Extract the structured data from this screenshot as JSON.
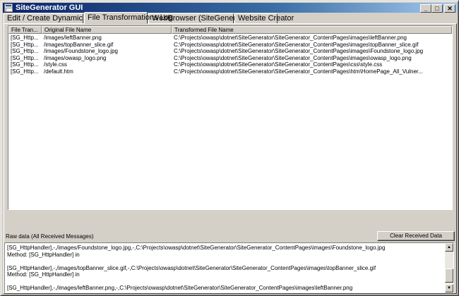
{
  "window": {
    "title": "SiteGenerator GUI",
    "controls": {
      "minimize": "_",
      "maximize": "□",
      "close": "✕"
    }
  },
  "tabs": [
    {
      "label": "Edit / Create Dynamic Websites"
    },
    {
      "label": "File Transformations Log"
    },
    {
      "label": "WebBrowser (SiteGenerator Sites)"
    },
    {
      "label": "Website Creator"
    }
  ],
  "log_table": {
    "columns": [
      "File Tran...",
      "Original File Name",
      "Transformed File Name"
    ],
    "rows": [
      [
        "[SG_Http...",
        "/images/leftBanner.png",
        "C:\\Projects\\owasp\\dotnet\\SiteGenerator\\SiteGenerator_ContentPages\\images\\leftBanner.png"
      ],
      [
        "[SG_Http...",
        "/images/topBanner_slice.gif",
        "C:\\Projects\\owasp\\dotnet\\SiteGenerator\\SiteGenerator_ContentPages\\images\\topBanner_slice.gif"
      ],
      [
        "[SG_Http...",
        "/images/Foundstone_logo.jpg",
        "C:\\Projects\\owasp\\dotnet\\SiteGenerator\\SiteGenerator_ContentPages\\images\\Foundstone_logo.jpg"
      ],
      [
        "[SG_Http...",
        "/images/owasp_logo.png",
        "C:\\Projects\\owasp\\dotnet\\SiteGenerator\\SiteGenerator_ContentPages\\images\\owasp_logo.png"
      ],
      [
        "[SG_Http...",
        "/style.css",
        "C:\\Projects\\owasp\\dotnet\\SiteGenerator\\SiteGenerator_ContentPages\\css\\style.css"
      ],
      [
        "[SG_Http...",
        "/default.htm",
        "C:\\Projects\\owasp\\dotnet\\SiteGenerator\\SiteGenerator_ContentPages\\htm\\HomePage_All_Vulner..."
      ]
    ]
  },
  "raw_data": {
    "label": "Raw data (All  Received Messages)",
    "clear_button": "Clear Received Data",
    "lines": [
      "[SG_HttpHandler],-,/images/Foundstone_logo.jpg,-,C:\\Projects\\owasp\\dotnet\\SiteGenerator\\SiteGenerator_ContentPages\\images\\Foundstone_logo.jpg",
      "Method: [SG_HttpHandler] in",
      "",
      "[SG_HttpHandler],-,/images/topBanner_slice.gif,-,C:\\Projects\\owasp\\dotnet\\SiteGenerator\\SiteGenerator_ContentPages\\images\\topBanner_slice.gif",
      "Method: [SG_HttpHandler] in",
      "",
      "[SG_HttpHandler],-,/images/leftBanner.png,-,C:\\Projects\\owasp\\dotnet\\SiteGenerator\\SiteGenerator_ContentPages\\images\\leftBanner.png"
    ]
  },
  "icons": {
    "app": "app-window-icon",
    "scroll_up": "scroll-up-arrow-icon",
    "scroll_down": "scroll-down-arrow-icon"
  },
  "colors": {
    "titlebar_start": "#0a246a",
    "titlebar_end": "#a6caf0",
    "face": "#d4d0c8"
  }
}
